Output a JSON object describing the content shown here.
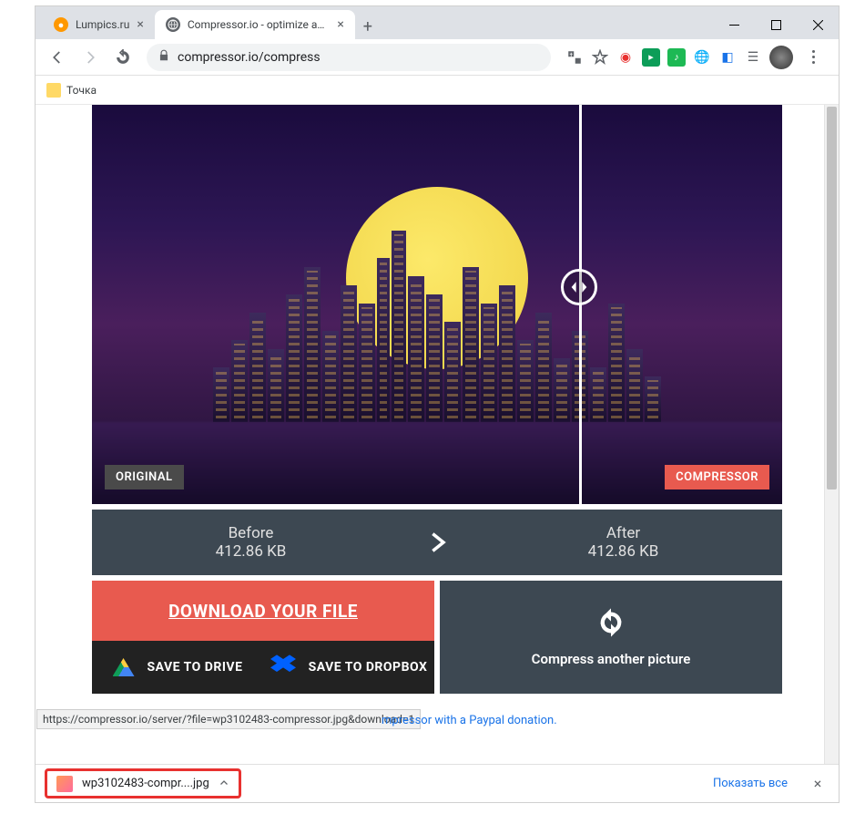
{
  "tabs": [
    {
      "title": "Lumpics.ru",
      "favicon": "orange"
    },
    {
      "title": "Compressor.io - optimize and co",
      "favicon": "gray"
    }
  ],
  "url": "compressor.io/compress",
  "bookmark": {
    "label": "Точка"
  },
  "comparison": {
    "original_label": "ORIGINAL",
    "compressor_label": "COMPRESSOR"
  },
  "stats": {
    "before_label": "Before",
    "before_value": "412.86 KB",
    "after_label": "After",
    "after_value": "412.86 KB"
  },
  "actions": {
    "download": "DOWNLOAD YOUR FILE",
    "drive": "SAVE TO DRIVE",
    "dropbox": "SAVE TO DROPBOX",
    "another": "Compress another picture"
  },
  "status_url": "https://compressor.io/server/?file=wp3102483-compressor.jpg&download=1",
  "donation_tail": "mpressor with a Paypal donation.",
  "downloads": {
    "item_name": "wp3102483-compr....jpg",
    "show_all": "Показать все"
  }
}
